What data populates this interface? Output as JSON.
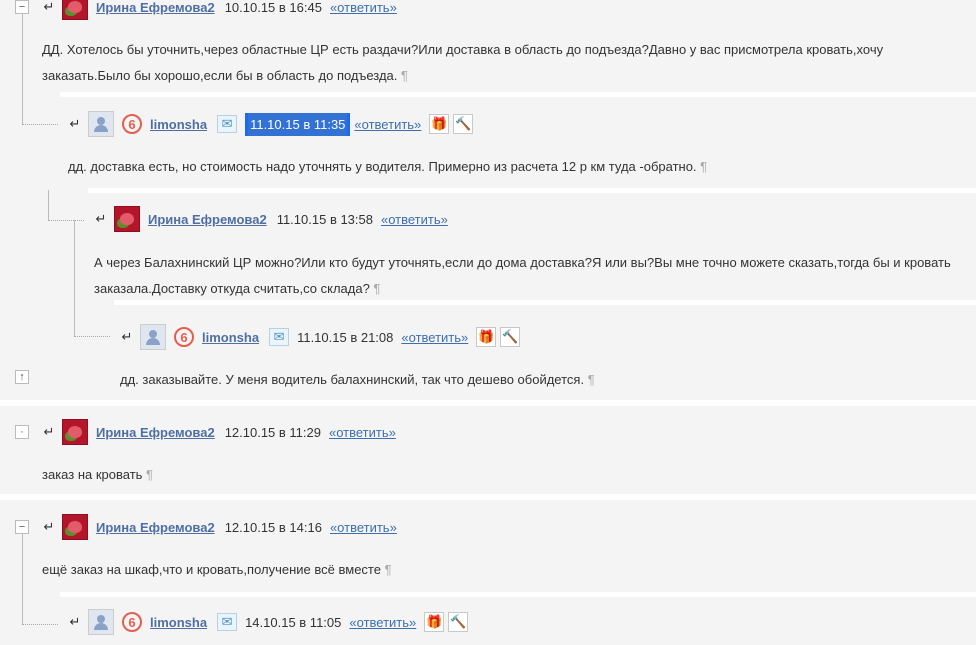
{
  "ui": {
    "reply_arrow": "↵",
    "pilcrow": "¶",
    "answer_label": "«ответить»",
    "badge_text": "6",
    "mail_glyph": "✉",
    "gift_glyph": "🎁",
    "hammer_glyph": "🔨"
  },
  "comments": [
    {
      "user": "Ирина Ефремова2",
      "date": "10.10.15 в 16:45",
      "text": "ДД. Хотелось бы уточнить,через областные ЦР есть раздачи?Или доставка в область до подъезда?Давно у вас присмотрела кровать,хочу заказать.Было бы хорошо,если бы в область до подъезда.",
      "toggle": "−"
    },
    {
      "user": "limonsha",
      "date": "11.10.15 в 11:35",
      "text": "дд. доставка есть, но стоимость надо уточнять у водителя. Примерно из расчета 12 р км туда -обратно."
    },
    {
      "user": "Ирина Ефремова2",
      "date": "11.10.15 в 13:58",
      "text": "А через Балахнинский ЦР можно?Или кто будут уточнять,если до дома доставка?Я или вы?Вы мне точно можете сказать,тогда бы и кровать заказала.Доставку откуда считать,со склада?"
    },
    {
      "user": "limonsha",
      "date": "11.10.15 в 21:08",
      "text": "дд. заказывайте. У меня водитель балахнинский, так что дешево обойдется."
    },
    {
      "user": "Ирина Ефремова2",
      "date": "12.10.15 в 11:29",
      "text": "заказ на кровать",
      "toggle": "·"
    },
    {
      "user": "Ирина Ефремова2",
      "date": "12.10.15 в 14:16",
      "text": "ещё заказ на шкаф,что и кровать,получение всё вместе",
      "toggle": "−"
    },
    {
      "user": "limonsha",
      "date": "14.10.15 в 11:05",
      "text": ""
    }
  ],
  "scroll_top_glyph": "↑"
}
